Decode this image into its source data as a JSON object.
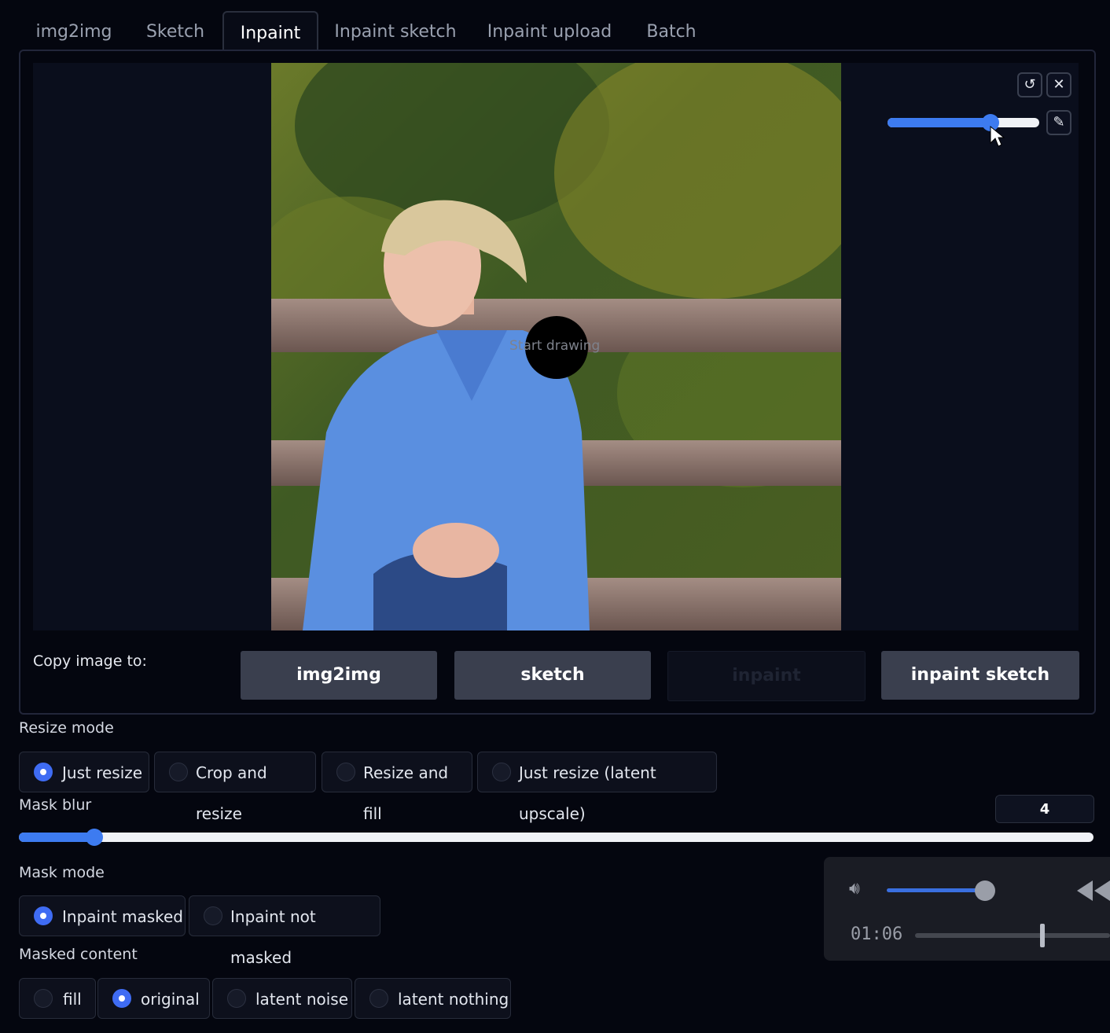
{
  "tabs": [
    {
      "label": "img2img",
      "active": false
    },
    {
      "label": "Sketch",
      "active": false
    },
    {
      "label": "Inpaint",
      "active": true
    },
    {
      "label": "Inpaint sketch",
      "active": false
    },
    {
      "label": "Inpaint upload",
      "active": false
    },
    {
      "label": "Batch",
      "active": false
    }
  ],
  "canvas": {
    "overlay_text": "Start drawing",
    "brush_size_fraction": 0.68,
    "tools": [
      "undo-icon",
      "close-icon",
      "brush-icon"
    ]
  },
  "copy_image": {
    "label": "Copy image to:",
    "buttons": [
      "img2img",
      "sketch",
      "inpaint",
      "inpaint sketch"
    ]
  },
  "resize_mode": {
    "label": "Resize mode",
    "options": [
      "Just resize",
      "Crop and resize",
      "Resize and fill",
      "Just resize (latent upscale)"
    ],
    "selected": "Just resize"
  },
  "mask_blur": {
    "label": "Mask blur",
    "value": "4",
    "min": 0,
    "max": 64
  },
  "mask_mode": {
    "label": "Mask mode",
    "options": [
      "Inpaint masked",
      "Inpaint not masked"
    ],
    "selected": "Inpaint masked"
  },
  "masked_content": {
    "label": "Masked content",
    "options": [
      "fill",
      "original",
      "latent noise",
      "latent nothing"
    ],
    "selected": "original"
  },
  "media_player": {
    "time": "01:06",
    "volume_fraction": 0.9
  },
  "colors": {
    "accent": "#3d7bf0",
    "background": "#04060f"
  }
}
